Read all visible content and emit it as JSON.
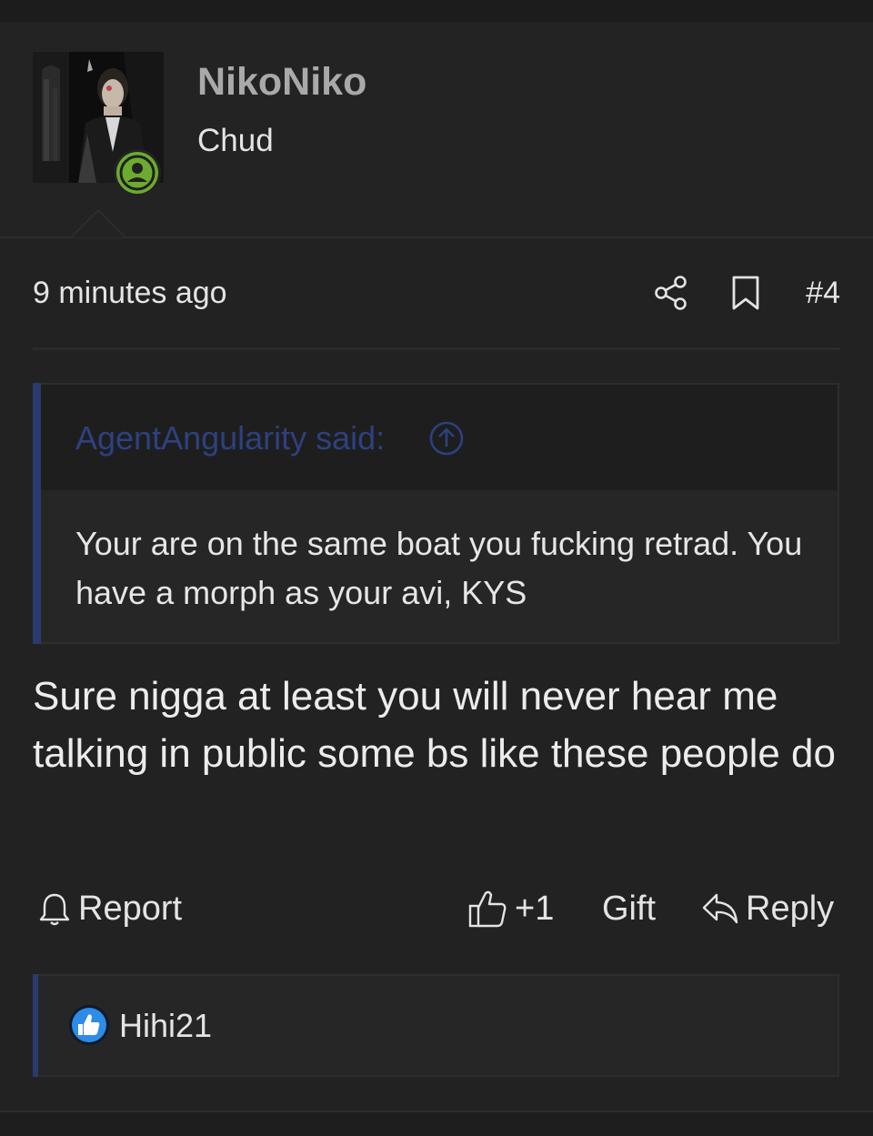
{
  "post": {
    "author": {
      "username": "NikoNiko",
      "title": "Chud",
      "online": true,
      "avatar_icon": "avatar-image"
    },
    "meta": {
      "timestamp": "9 minutes ago",
      "post_number": "#4",
      "share_icon": "share-icon",
      "bookmark_icon": "bookmark-icon"
    },
    "quote": {
      "author_label": "AgentAngularity said:",
      "jump_icon": "arrow-up-circle-icon",
      "body": "Your are on the same boat you fucking retrad. You have a morph as your avi, KYS"
    },
    "message": "Sure nigga at least you will never hear me talking in public some bs like these people do",
    "actions": {
      "report_label": "Report",
      "like_label": "+1",
      "gift_label": "Gift",
      "reply_label": "Reply"
    },
    "reactions": {
      "reactor": "Hihi21",
      "reaction_icon": "thumbs-up-badge-icon"
    }
  },
  "colors": {
    "background": "#222222",
    "header_bg": "#232323",
    "quote_accent": "#2a3a6e",
    "quote_author": "#2d4180",
    "online_badge": "#6cab2f",
    "like_badge": "#2d8ce6"
  }
}
